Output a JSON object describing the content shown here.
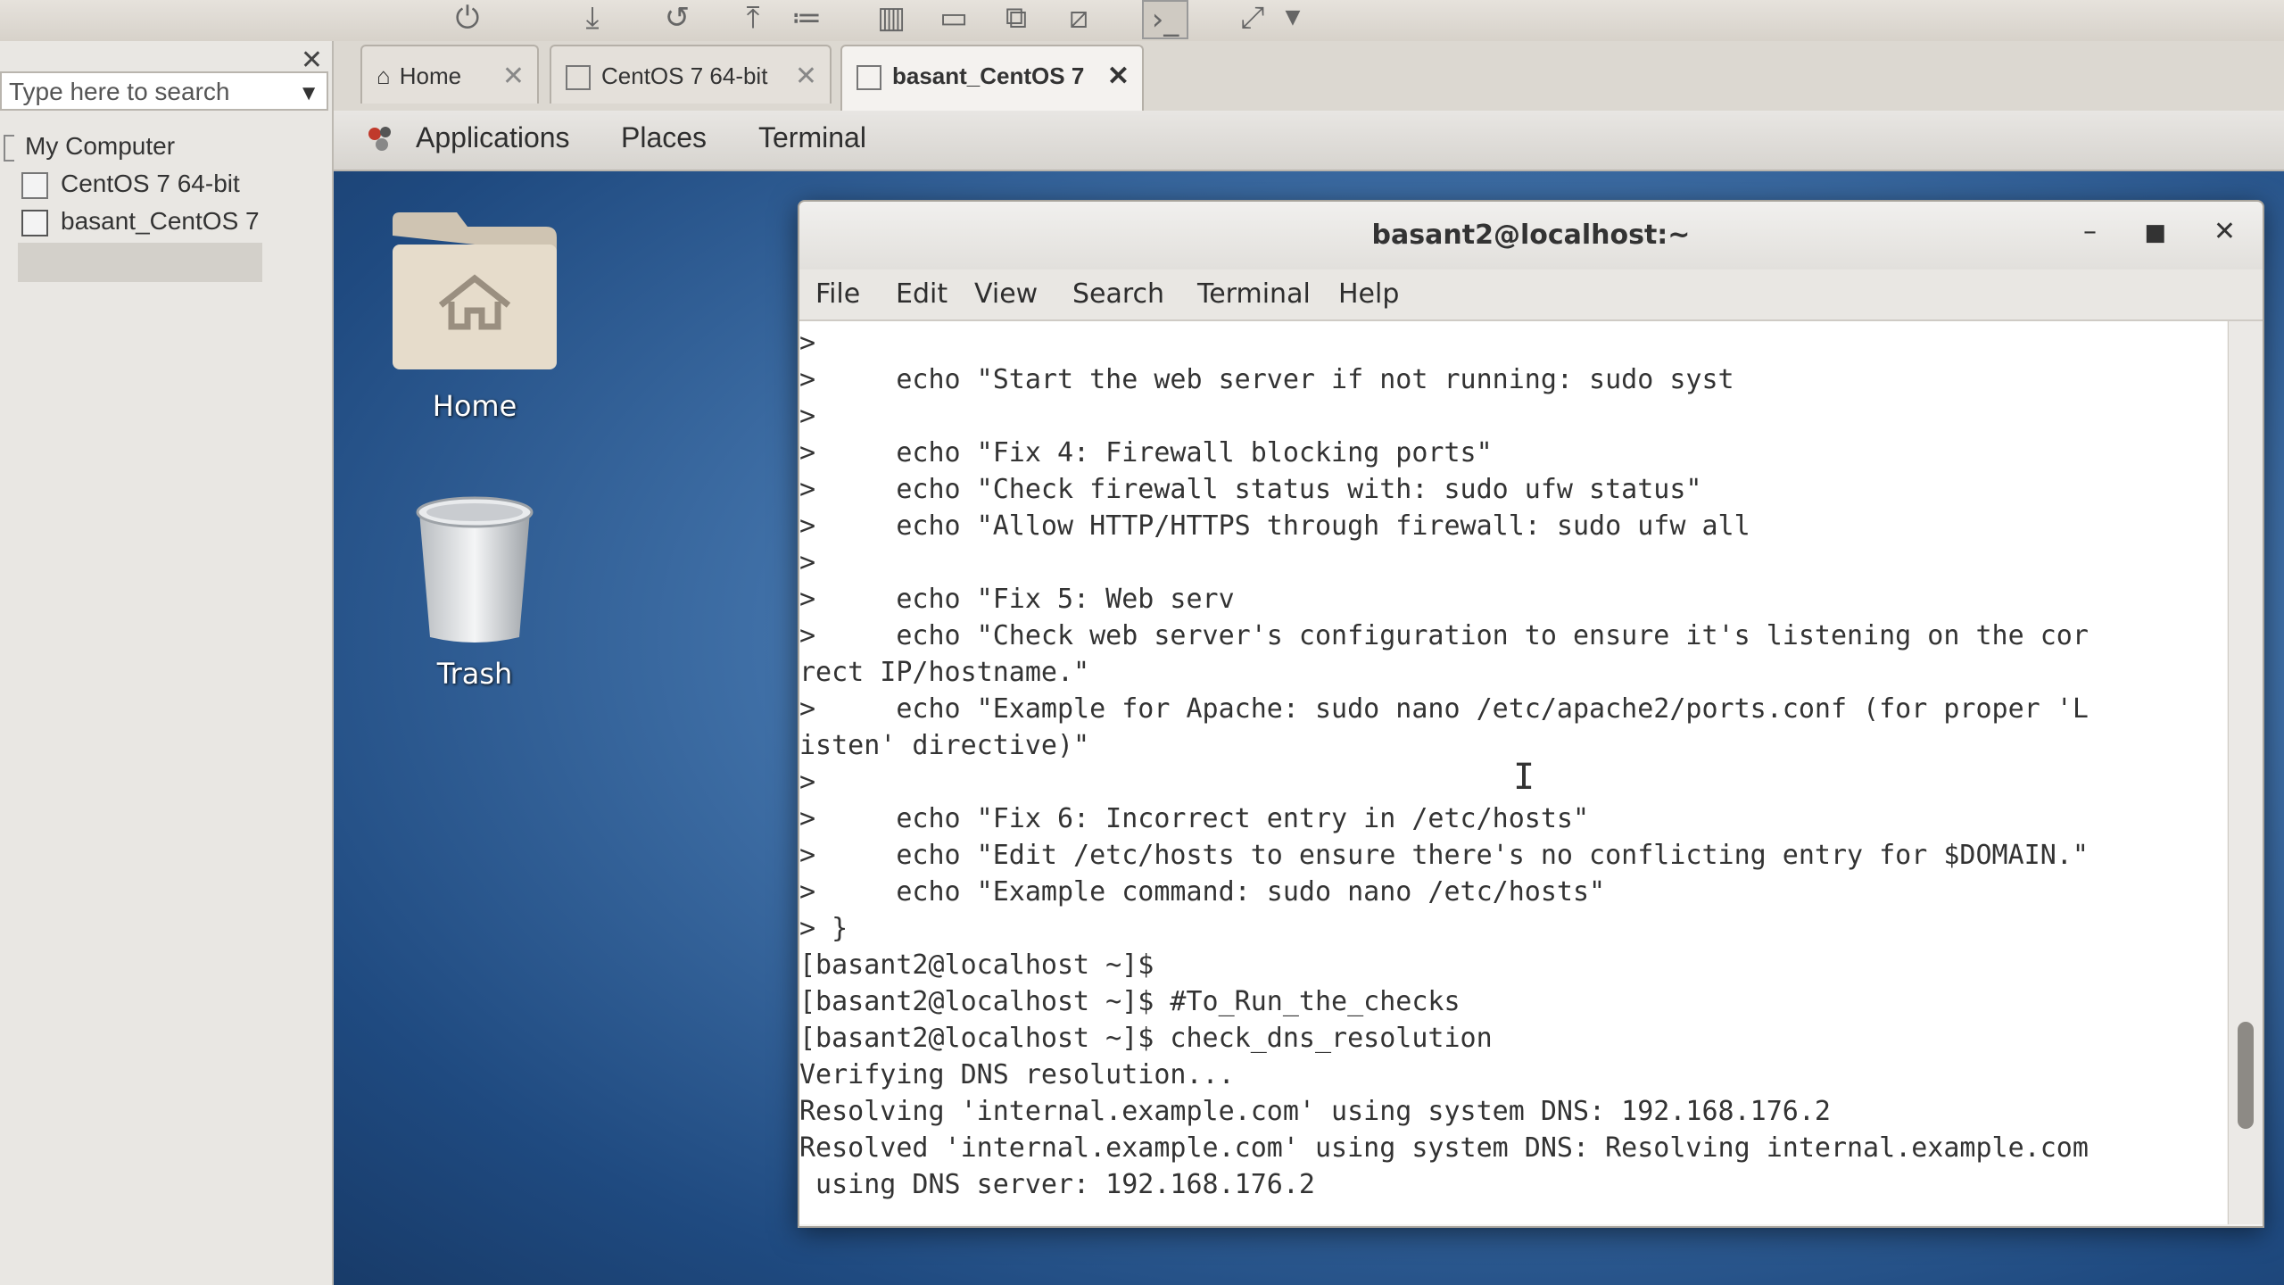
{
  "library": {
    "search_placeholder": "Type here to search",
    "tree": [
      {
        "label": "My Computer"
      },
      {
        "label": "CentOS 7 64-bit"
      },
      {
        "label": "basant_CentOS 7",
        "selected": true
      }
    ]
  },
  "tabs": [
    {
      "label": "Home"
    },
    {
      "label": "CentOS 7 64-bit"
    },
    {
      "label": "basant_CentOS 7",
      "active": true
    }
  ],
  "gnome_bar": {
    "applications": "Applications",
    "places": "Places",
    "terminal": "Terminal"
  },
  "desktop": {
    "icons": [
      {
        "label": "Home"
      },
      {
        "label": "Trash"
      }
    ]
  },
  "terminal": {
    "title": "basant2@localhost:~",
    "menu": [
      "File",
      "Edit",
      "View",
      "Search",
      "Terminal",
      "Help"
    ],
    "lines": [
      ">",
      ">     echo \"Start the web server if not running: sudo syst",
      ">",
      ">     echo \"Fix 4: Firewall blocking ports\"",
      ">     echo \"Check firewall status with: sudo ufw status\"",
      ">     echo \"Allow HTTP/HTTPS through firewall: sudo ufw all",
      ">",
      ">     echo \"Fix 5: Web serv",
      ">     echo \"Check web server's configuration to ensure it's listening on the cor",
      "rect IP/hostname.\"",
      ">     echo \"Example for Apache: sudo nano /etc/apache2/ports.conf (for proper 'L",
      "isten' directive)\"",
      ">",
      ">     echo \"Fix 6: Incorrect entry in /etc/hosts\"",
      ">     echo \"Edit /etc/hosts to ensure there's no conflicting entry for $DOMAIN.\"",
      ">     echo \"Example command: sudo nano /etc/hosts\"",
      "> }",
      "[basant2@localhost ~]$",
      "[basant2@localhost ~]$ #To_Run_the_checks",
      "[basant2@localhost ~]$ check_dns_resolution",
      "Verifying DNS resolution...",
      "Resolving 'internal.example.com' using system DNS: 192.168.176.2",
      "Resolved 'internal.example.com' using system DNS: Resolving internal.example.com",
      " using DNS server: 192.168.176.2"
    ],
    "scroll_position": 0.9
  }
}
